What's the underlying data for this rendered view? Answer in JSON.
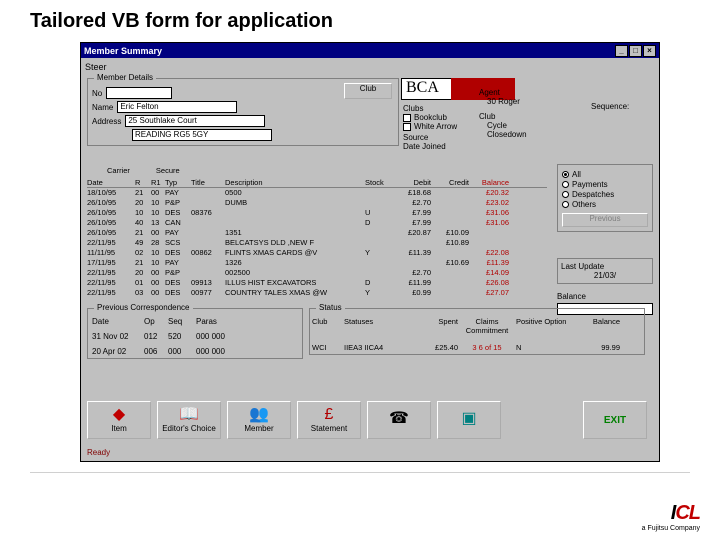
{
  "slide": {
    "title": "Tailored VB form for application"
  },
  "window": {
    "title": "Member Summary"
  },
  "steer": "Steer",
  "member": {
    "group_label": "Member Details",
    "no_label": "No",
    "no_value": "",
    "name_label": "Name",
    "name_value": "Eric Felton",
    "address_label": "Address",
    "address_line1": "25 Southlake Court",
    "address_line2": "READING   RG5 5GY",
    "club_button": "Club"
  },
  "bca": "BCA",
  "clubs": {
    "label": "Clubs",
    "items": [
      "Bookclub",
      "White Arrow"
    ],
    "source_label": "Source",
    "date_joined_label": "Date Joined"
  },
  "agent": {
    "label": "Agent",
    "value": "30 Roger"
  },
  "club_meta": {
    "label": "Club",
    "cycle_label": "Cycle",
    "closedown_label": "Closedown"
  },
  "sequence_label": "Sequence:",
  "carrier": "Carrier",
  "secure": "Secure",
  "tx_headers": {
    "date": "Date",
    "r1": "R",
    "r2": "R1",
    "type": "Typ",
    "title": "Title",
    "desc": "Description",
    "stock": "Stock",
    "debit": "Debit",
    "credit": "Credit",
    "balance": "Balance"
  },
  "tx": [
    {
      "date": "18/10/95",
      "r1": "21",
      "r2": "00",
      "type": "PAY",
      "title": "",
      "desc": "0500",
      "stock": "",
      "debit": "£18.68",
      "credit": "",
      "balance": "£20.32"
    },
    {
      "date": "26/10/95",
      "r1": "20",
      "r2": "10",
      "type": "P&P",
      "title": "",
      "desc": "DUMB",
      "stock": "",
      "debit": "£2.70",
      "credit": "",
      "balance": "£23.02"
    },
    {
      "date": "26/10/95",
      "r1": "10",
      "r2": "10",
      "type": "DES",
      "title": "08376",
      "desc": "",
      "stock": "U",
      "debit": "£7.99",
      "credit": "",
      "balance": "£31.06"
    },
    {
      "date": "26/10/95",
      "r1": "40",
      "r2": "13",
      "type": "CAN",
      "title": "",
      "desc": "",
      "stock": "D",
      "debit": "£7.99",
      "credit": "",
      "balance": "£31.06"
    },
    {
      "date": "26/10/95",
      "r1": "21",
      "r2": "00",
      "type": "PAY",
      "title": "",
      "desc": "1351",
      "stock": "",
      "debit": "£20.87",
      "credit": "£10.09",
      "balance": ""
    },
    {
      "date": "22/11/95",
      "r1": "49",
      "r2": "28",
      "type": "SCS",
      "title": "",
      "desc": "BELCATSYS  DLD  ,NEW F",
      "stock": "",
      "debit": "",
      "credit": "£10.89",
      "balance": ""
    },
    {
      "date": "11/11/95",
      "r1": "02",
      "r2": "10",
      "type": "DES",
      "title": "00862",
      "desc": "FLINTS XMAS CARDS  @V",
      "stock": "Y",
      "debit": "£11.39",
      "credit": "",
      "balance": "£22.08"
    },
    {
      "date": "17/11/95",
      "r1": "21",
      "r2": "10",
      "type": "PAY",
      "title": "",
      "desc": "1326",
      "stock": "",
      "debit": "",
      "credit": "£10.69",
      "balance": "£11.39"
    },
    {
      "date": "22/11/95",
      "r1": "20",
      "r2": "00",
      "type": "P&P",
      "title": "",
      "desc": "002500",
      "stock": "",
      "debit": "£2.70",
      "credit": "",
      "balance": "£14.09"
    },
    {
      "date": "22/11/95",
      "r1": "01",
      "r2": "00",
      "type": "DES",
      "title": "09913",
      "desc": "ILLUS HIST EXCAVATORS",
      "stock": "D",
      "debit": "£11.99",
      "credit": "",
      "balance": "£26.08"
    },
    {
      "date": "22/11/95",
      "r1": "03",
      "r2": "00",
      "type": "DES",
      "title": "00977",
      "desc": "COUNTRY TALES XMAS  @W",
      "stock": "Y",
      "debit": "£0.99",
      "credit": "",
      "balance": "£27.07"
    }
  ],
  "filter": {
    "options": [
      "All",
      "Payments",
      "Despatches",
      "Others"
    ],
    "selected": 0,
    "previous_btn": "Previous"
  },
  "last_update": {
    "label": "Last Update",
    "value": "21/03/"
  },
  "balance": {
    "label": "Balance"
  },
  "prev_corr": {
    "label": "Previous Correspondence",
    "headers": {
      "date": "Date",
      "op": "Op",
      "seq": "Seq",
      "paras": "Paras"
    },
    "rows": [
      {
        "date": "31 Nov 02",
        "op": "012",
        "seq": "520",
        "paras": "000  000"
      },
      {
        "date": "20 Apr 02",
        "op": "006",
        "seq": "000",
        "paras": "000  000"
      }
    ]
  },
  "status": {
    "label": "Status",
    "headers": {
      "club": "Club",
      "statuses": "Statuses",
      "spent": "Spent",
      "claims": "Claims Commitment",
      "positive": "Positive Option",
      "balance": "Balance"
    },
    "row": {
      "club": "WCI",
      "statuses": "IIEA3  IICA4",
      "spent": "£25.40",
      "claims": "3    6 of 15",
      "positive": "N",
      "balance": "99.99"
    }
  },
  "buttons": {
    "item": "Item",
    "editors": "Editor's Choice",
    "member": "Member",
    "statement": "Statement",
    "payment": "",
    "query": "",
    "exit": "EXIT"
  },
  "ready": "Ready",
  "footer": {
    "logo": "ICL",
    "sub": "a Fujitsu Company"
  }
}
